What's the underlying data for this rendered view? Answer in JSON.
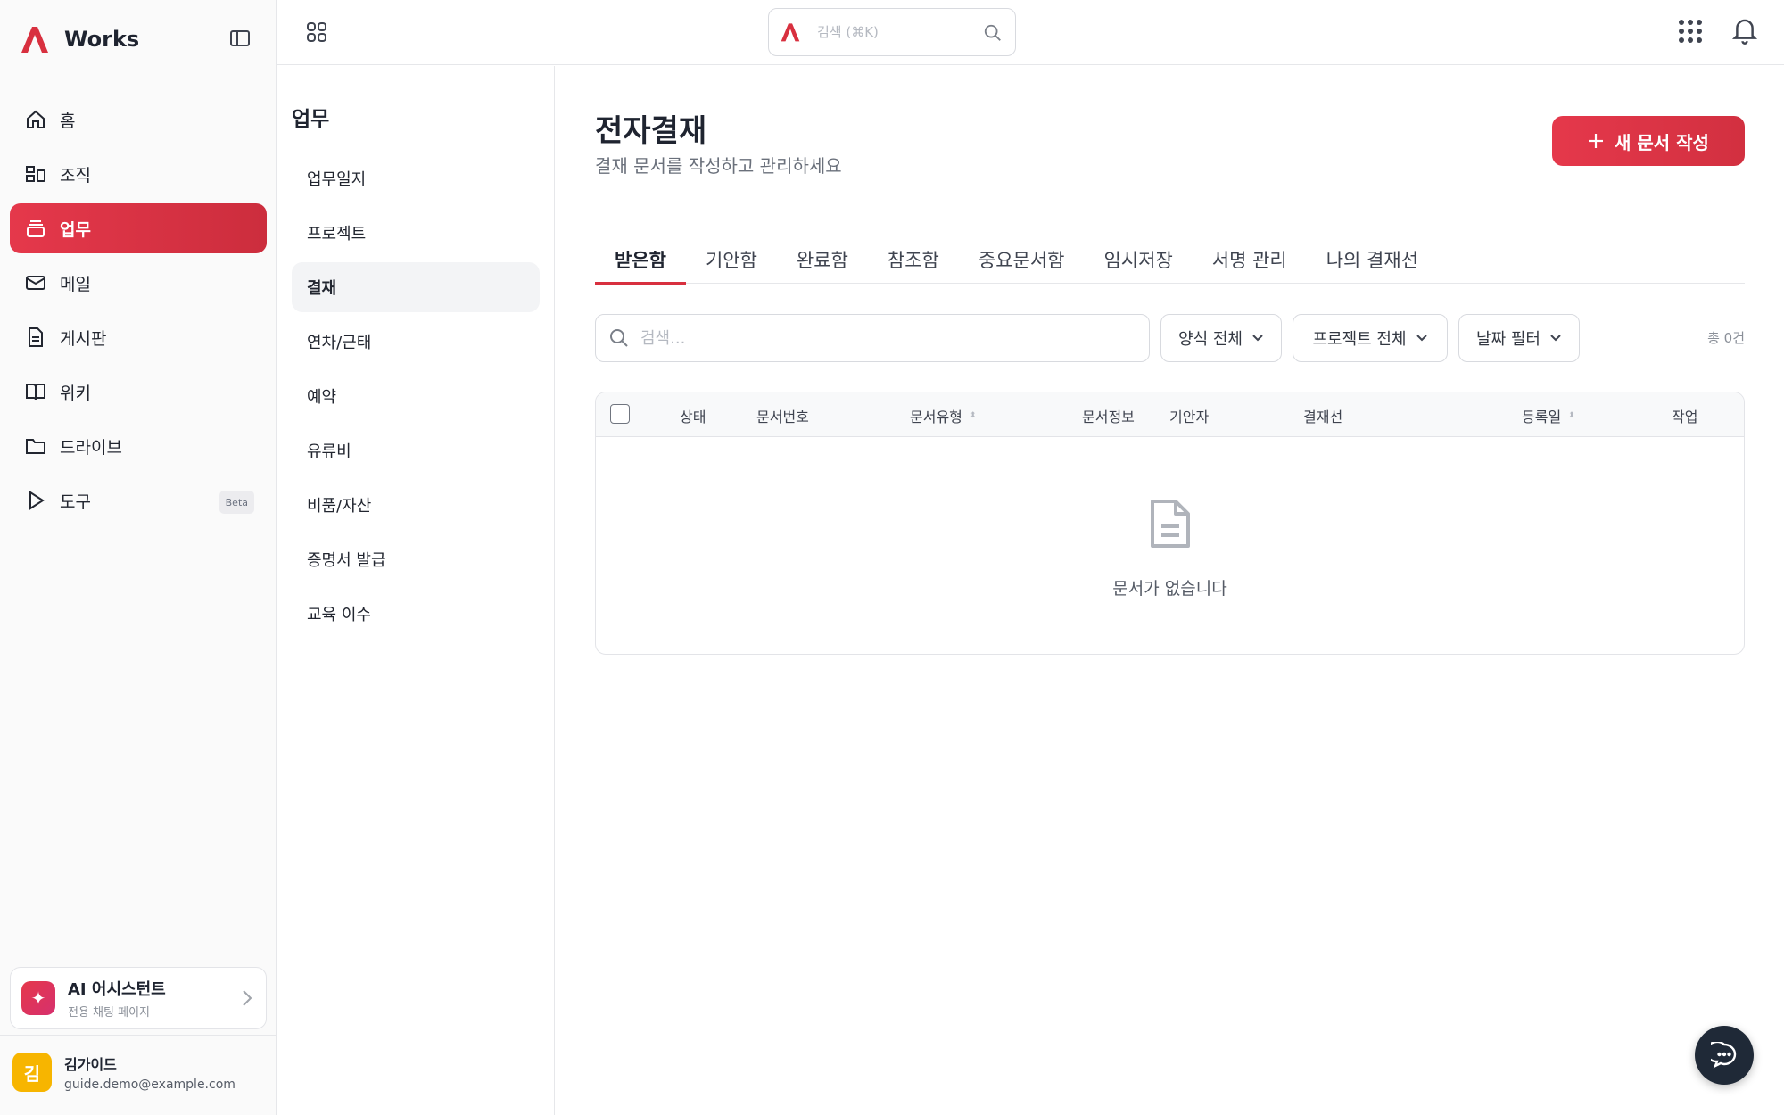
{
  "brand": {
    "name": "Works",
    "accent": "#D8303F"
  },
  "sidebar": {
    "items": [
      {
        "label": "홈",
        "icon": "home-icon"
      },
      {
        "label": "조직",
        "icon": "org-icon"
      },
      {
        "label": "업무",
        "icon": "work-icon",
        "active": true
      },
      {
        "label": "메일",
        "icon": "mail-icon"
      },
      {
        "label": "게시판",
        "icon": "board-icon"
      },
      {
        "label": "위키",
        "icon": "book-icon"
      },
      {
        "label": "드라이브",
        "icon": "folder-icon"
      },
      {
        "label": "도구",
        "icon": "play-icon",
        "badge": "Beta"
      }
    ],
    "ai_card": {
      "title": "AI 어시스턴트",
      "subtitle": "전용 채팅 페이지"
    },
    "user": {
      "initial": "김",
      "name": "김가이드",
      "email": "guide.demo@example.com"
    }
  },
  "topbar": {
    "search_placeholder": "검색 (⌘K)"
  },
  "subnav": {
    "title": "업무",
    "items": [
      {
        "label": "업무일지"
      },
      {
        "label": "프로젝트"
      },
      {
        "label": "결재",
        "active": true
      },
      {
        "label": "연차/근태"
      },
      {
        "label": "예약"
      },
      {
        "label": "유류비"
      },
      {
        "label": "비품/자산"
      },
      {
        "label": "증명서 발급"
      },
      {
        "label": "교육 이수"
      }
    ]
  },
  "main": {
    "title": "전자결재",
    "subtitle": "결재 문서를 작성하고 관리하세요",
    "new_doc_label": "새 문서 작성",
    "tabs": [
      {
        "label": "받은함",
        "active": true
      },
      {
        "label": "기안함"
      },
      {
        "label": "완료함"
      },
      {
        "label": "참조함"
      },
      {
        "label": "중요문서함"
      },
      {
        "label": "임시저장"
      },
      {
        "label": "서명 관리"
      },
      {
        "label": "나의 결재선"
      }
    ],
    "search_placeholder": "검색...",
    "filters": {
      "form": "양식 전체",
      "project": "프로젝트 전체",
      "date": "날짜 필터"
    },
    "total": "총 0건",
    "table": {
      "columns": [
        "상태",
        "문서번호",
        "문서유형",
        "문서정보",
        "기안자",
        "결재선",
        "등록일",
        "작업"
      ],
      "rows": [],
      "empty_text": "문서가 없습니다"
    }
  }
}
